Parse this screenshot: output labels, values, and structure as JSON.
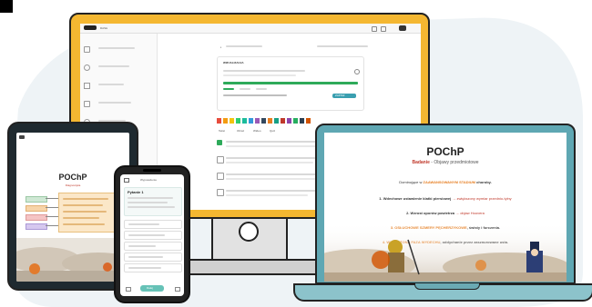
{
  "monitor": {
    "header_title": "DASH",
    "panel_title": "WIZUALIZACJA",
    "action_label": "ZAPISZ",
    "tabs": [
      "Tekst",
      "Obraz",
      "Wideo",
      "Quiz"
    ]
  },
  "tablet": {
    "title": "POChP",
    "subtitle": "Diagnostyka"
  },
  "phone": {
    "header": "Wyposażenie",
    "question_title": "Pytanie 1",
    "button_label": "Dalej"
  },
  "laptop": {
    "title": "POChP",
    "subtitle_bold": "Badanie",
    "subtitle_rest": " - Objawy przedmiotowe",
    "intro_pre": "Dominujące w ",
    "intro_highlight": "ZAAWANSOWANYM STADIUM",
    "intro_post": " choroby.",
    "item1_bold": "1. Wdechowe ustawienie klatki piersiowej",
    "item1_rest": " → zwiększony wymiar przednio-tylny",
    "item2_bold": "2. Wzrost oporów powietrza",
    "item2_rest": " → objaw Hoovera",
    "item3_highlight": "3. OSŁUCHOWE SZMERY PĘCHERZYKOWE",
    "item3_rest": ", świsty i furczenia.",
    "item4_highlight": "4. WYDŁUŻONA FAZA WYDECHU",
    "item4_rest": ", oddychanie przez zasznurowane usta."
  }
}
